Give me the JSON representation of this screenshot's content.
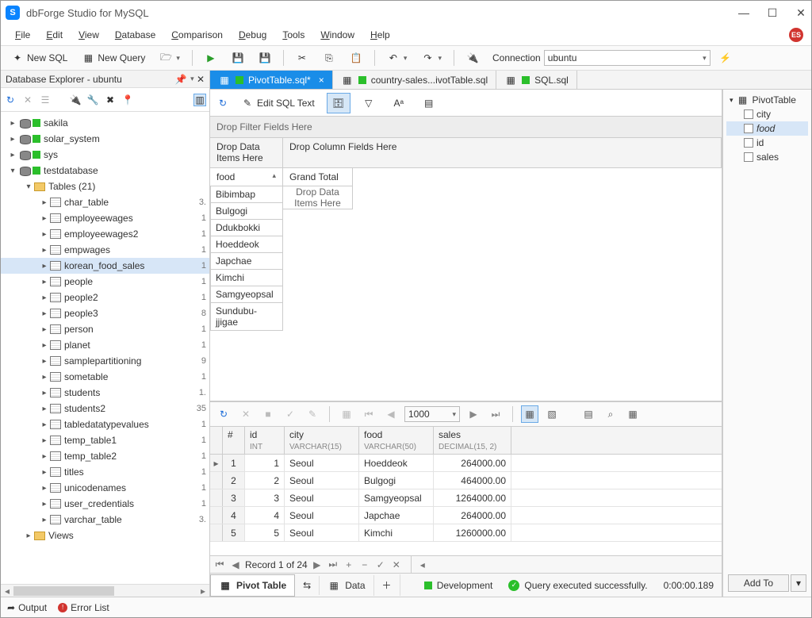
{
  "window": {
    "title": "dbForge Studio for MySQL"
  },
  "menu": [
    "File",
    "Edit",
    "View",
    "Database",
    "Comparison",
    "Debug",
    "Tools",
    "Window",
    "Help"
  ],
  "badge": "ES",
  "toolbar": {
    "new_sql": "New SQL",
    "new_query": "New Query",
    "connection_label": "Connection",
    "connection_value": "ubuntu"
  },
  "explorer": {
    "title": "Database Explorer - ubuntu",
    "dbs": [
      "sakila",
      "solar_system",
      "sys",
      "testdatabase"
    ],
    "tables_label": "Tables (21)",
    "tables": [
      {
        "n": "char_table",
        "c": "3."
      },
      {
        "n": "employeewages",
        "c": "1"
      },
      {
        "n": "employeewages2",
        "c": "1"
      },
      {
        "n": "empwages",
        "c": "1"
      },
      {
        "n": "korean_food_sales",
        "c": "1"
      },
      {
        "n": "people",
        "c": "1"
      },
      {
        "n": "people2",
        "c": "1"
      },
      {
        "n": "people3",
        "c": "8"
      },
      {
        "n": "person",
        "c": "1"
      },
      {
        "n": "planet",
        "c": "1"
      },
      {
        "n": "samplepartitioning",
        "c": "9"
      },
      {
        "n": "sometable",
        "c": "1"
      },
      {
        "n": "students",
        "c": "1."
      },
      {
        "n": "students2",
        "c": "35"
      },
      {
        "n": "tabledatatypevalues",
        "c": "1"
      },
      {
        "n": "temp_table1",
        "c": "1"
      },
      {
        "n": "temp_table2",
        "c": "1"
      },
      {
        "n": "titles",
        "c": "1"
      },
      {
        "n": "unicodenames",
        "c": "1"
      },
      {
        "n": "user_credentials",
        "c": "1"
      },
      {
        "n": "varchar_table",
        "c": "3."
      }
    ],
    "views": "Views",
    "selected": "korean_food_sales"
  },
  "tabs": [
    {
      "label": "PivotTable.sql*",
      "active": true,
      "closable": true
    },
    {
      "label": "country-sales...ivotTable.sql",
      "active": false
    },
    {
      "label": "SQL.sql",
      "active": false
    }
  ],
  "editor": {
    "edit_btn": "Edit SQL Text",
    "drop_filter": "Drop Filter Fields Here",
    "drop_data_items": "Drop Data Items Here",
    "drop_columns": "Drop Column Fields Here",
    "row_field": "food",
    "grand_total": "Grand Total",
    "foods": [
      "Bibimbap",
      "Bulgogi",
      "Ddukbokki",
      "Hoeddeok",
      "Japchae",
      "Kimchi",
      "Samgyeopsal",
      "Sundubu-jjigae"
    ],
    "drop_center": "Drop Data Items Here"
  },
  "grid": {
    "page_size": "1000",
    "columns": [
      {
        "n": "#",
        "t": ""
      },
      {
        "n": "id",
        "t": "INT"
      },
      {
        "n": "city",
        "t": "VARCHAR(15)"
      },
      {
        "n": "food",
        "t": "VARCHAR(50)"
      },
      {
        "n": "sales",
        "t": "DECIMAL(15, 2)"
      }
    ],
    "rows": [
      {
        "i": 1,
        "id": 1,
        "city": "Seoul",
        "food": "Hoeddeok",
        "sales": "264000.00"
      },
      {
        "i": 2,
        "id": 2,
        "city": "Seoul",
        "food": "Bulgogi",
        "sales": "464000.00"
      },
      {
        "i": 3,
        "id": 3,
        "city": "Seoul",
        "food": "Samgyeopsal",
        "sales": "1264000.00"
      },
      {
        "i": 4,
        "id": 4,
        "city": "Seoul",
        "food": "Japchae",
        "sales": "264000.00"
      },
      {
        "i": 5,
        "id": 5,
        "city": "Seoul",
        "food": "Kimchi",
        "sales": "1260000.00"
      }
    ],
    "record_text": "Record 1 of 24"
  },
  "bottom_tabs": {
    "pivot": "Pivot Table",
    "data": "Data",
    "dev": "Development",
    "status": "Query executed successfully.",
    "time": "0:00:00.189"
  },
  "right": {
    "root": "PivotTable",
    "fields": [
      "city",
      "food",
      "id",
      "sales"
    ],
    "selected": "food",
    "add_to": "Add To"
  },
  "footer": {
    "output": "Output",
    "errors": "Error List"
  }
}
